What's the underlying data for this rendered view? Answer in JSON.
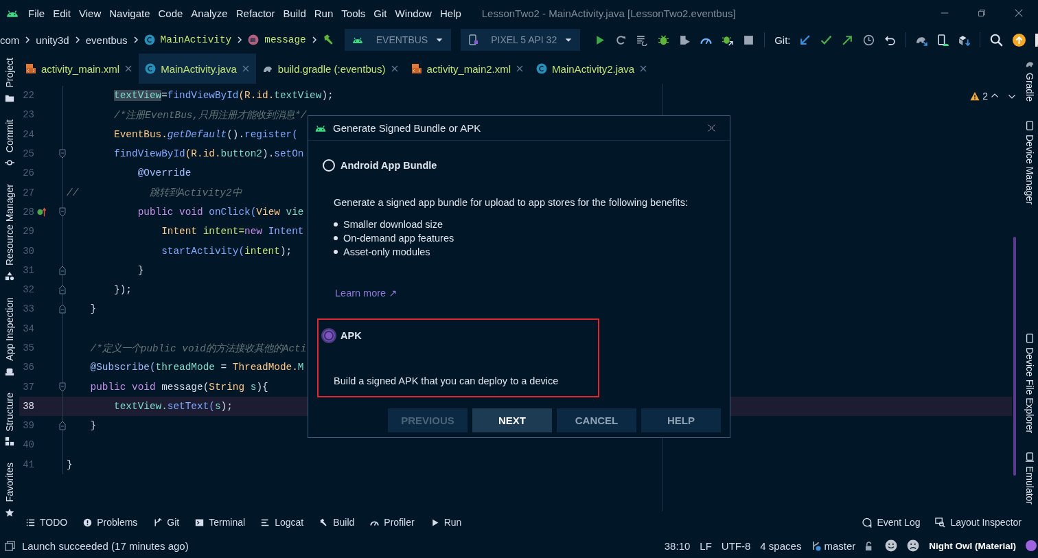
{
  "window": {
    "title": "LessonTwo2 - MainActivity.java [LessonTwo2.eventbus]"
  },
  "menu": [
    "File",
    "Edit",
    "View",
    "Navigate",
    "Code",
    "Analyze",
    "Refactor",
    "Build",
    "Run",
    "Tools",
    "Git",
    "Window",
    "Help"
  ],
  "breadcrumbs": [
    {
      "label": "com",
      "kind": "package"
    },
    {
      "label": "unity3d",
      "kind": "package"
    },
    {
      "label": "eventbus",
      "kind": "package"
    },
    {
      "label": "MainActivity",
      "kind": "class"
    },
    {
      "label": "message",
      "kind": "method"
    }
  ],
  "toolbar": {
    "run_config": "EVENTBUS",
    "device": "PIXEL 5 API 32",
    "git_label": "Git:"
  },
  "tabs": [
    {
      "label": "activity_main.xml",
      "kind": "xml",
      "selected": false
    },
    {
      "label": "MainActivity.java",
      "kind": "class",
      "selected": true
    },
    {
      "label": "build.gradle (:eventbus)",
      "kind": "gradle",
      "selected": false
    },
    {
      "label": "activity_main2.xml",
      "kind": "xml",
      "selected": false
    },
    {
      "label": "MainActivity2.java",
      "kind": "class",
      "selected": false
    }
  ],
  "left_stripe": [
    "Project",
    "Commit",
    "Resource Manager",
    "App Inspection",
    "Structure",
    "Favorites"
  ],
  "right_stripe": {
    "top": [
      "Gradle",
      "Device Manager"
    ],
    "bottom": [
      "Device File Explorer",
      "Emulator"
    ]
  },
  "editor": {
    "inspections": "2",
    "lines": [
      {
        "number": "22",
        "current": false,
        "fold_open": false,
        "fold_close": false,
        "override": false,
        "tokens": [
          {
            "text": "        textView",
            "color": "#7fdbca",
            "selected": true
          },
          {
            "text": "=",
            "color": "#d6deeb"
          },
          {
            "text": "findViewById",
            "color": "#82aaff"
          },
          {
            "text": "(R.id.",
            "color": "#ffcb8b"
          },
          {
            "text": "textView",
            "color": "#7fdbca"
          },
          {
            "text": ");",
            "color": "#d6deeb"
          }
        ]
      },
      {
        "number": "23",
        "current": false,
        "fold_open": false,
        "fold_close": false,
        "override": false,
        "tokens": [
          {
            "text": "        /*注册EventBus,只用注册才能收到消息*/",
            "color": "#637777",
            "italic": true
          }
        ]
      },
      {
        "number": "24",
        "current": false,
        "fold_open": false,
        "fold_close": false,
        "override": false,
        "tokens": [
          {
            "text": "        EventBus.",
            "color": "#ffcb8b"
          },
          {
            "text": "getDefault",
            "color": "#82aaff",
            "italic": true
          },
          {
            "text": "().",
            "color": "#d6deeb"
          },
          {
            "text": "register(",
            "color": "#82aaff"
          }
        ]
      },
      {
        "number": "25",
        "current": false,
        "fold_open": true,
        "fold_close": false,
        "override": false,
        "tokens": [
          {
            "text": "        findViewById",
            "color": "#82aaff"
          },
          {
            "text": "(R.id.",
            "color": "#ffcb8b"
          },
          {
            "text": "button2",
            "color": "#7fdbca"
          },
          {
            "text": ").",
            "color": "#d6deeb"
          },
          {
            "text": "setOn",
            "color": "#82aaff"
          }
        ]
      },
      {
        "number": "26",
        "current": false,
        "fold_open": false,
        "fold_close": false,
        "override": false,
        "tokens": [
          {
            "text": "            @Override",
            "color": "#a2bffc"
          }
        ]
      },
      {
        "number": "27",
        "current": false,
        "fold_open": false,
        "fold_close": false,
        "override": false,
        "tokens": [
          {
            "text": "//            跳转到Activity2中",
            "color": "#637777",
            "italic": true
          }
        ]
      },
      {
        "number": "28",
        "current": false,
        "fold_open": true,
        "fold_close": false,
        "override": true,
        "tokens": [
          {
            "text": "            public void",
            "color": "#c792ea"
          },
          {
            "text": " onClick(",
            "color": "#82aaff"
          },
          {
            "text": "View",
            "color": "#ffcb8b"
          },
          {
            "text": " vie",
            "color": "#7fdbca"
          }
        ]
      },
      {
        "number": "29",
        "current": false,
        "fold_open": false,
        "fold_close": false,
        "override": false,
        "tokens": [
          {
            "text": "                Intent",
            "color": "#ffcb8b"
          },
          {
            "text": " intent=",
            "color": "#c5e478"
          },
          {
            "text": "new",
            "color": "#c792ea"
          },
          {
            "text": " Intent",
            "color": "#82aaff"
          }
        ]
      },
      {
        "number": "30",
        "current": false,
        "fold_open": false,
        "fold_close": false,
        "override": false,
        "tokens": [
          {
            "text": "                startActivity(",
            "color": "#82aaff"
          },
          {
            "text": "intent",
            "color": "#c5e478"
          },
          {
            "text": ");",
            "color": "#d6deeb"
          }
        ]
      },
      {
        "number": "31",
        "current": false,
        "fold_open": false,
        "fold_close": true,
        "override": false,
        "tokens": [
          {
            "text": "            }",
            "color": "#d6deeb"
          }
        ]
      },
      {
        "number": "32",
        "current": false,
        "fold_open": false,
        "fold_close": true,
        "override": false,
        "tokens": [
          {
            "text": "        });",
            "color": "#d6deeb"
          }
        ]
      },
      {
        "number": "33",
        "current": false,
        "fold_open": false,
        "fold_close": true,
        "override": false,
        "tokens": [
          {
            "text": "    }",
            "color": "#d6deeb"
          }
        ]
      },
      {
        "number": "34",
        "current": false,
        "fold_open": false,
        "fold_close": false,
        "override": false
      },
      {
        "number": "35",
        "current": false,
        "fold_open": false,
        "fold_close": false,
        "override": false,
        "tokens": [
          {
            "text": "    /*定义一个public void的方法接收其他的Acti",
            "color": "#637777",
            "italic": true
          }
        ]
      },
      {
        "number": "36",
        "current": false,
        "fold_open": false,
        "fold_close": false,
        "override": false,
        "tokens": [
          {
            "text": "    @Subscribe(",
            "color": "#a2bffc"
          },
          {
            "text": "threadMode",
            "color": "#7fdbca"
          },
          {
            "text": " = ",
            "color": "#d6deeb"
          },
          {
            "text": "ThreadMode.",
            "color": "#ffcb8b"
          },
          {
            "text": "M",
            "color": "#7fdbca"
          }
        ]
      },
      {
        "number": "37",
        "current": false,
        "fold_open": true,
        "fold_close": false,
        "override": false,
        "tokens": [
          {
            "text": "    public void",
            "color": "#c792ea"
          },
          {
            "text": " message(",
            "color": "#d6deeb"
          },
          {
            "text": "String",
            "color": "#ffcb8b"
          },
          {
            "text": " s",
            "color": "#7fdbca"
          },
          {
            "text": "){",
            "color": "#d6deeb"
          }
        ]
      },
      {
        "number": "38",
        "current": true,
        "fold_open": false,
        "fold_close": false,
        "override": false,
        "tokens": [
          {
            "text": "        textView.",
            "color": "#7fdbca"
          },
          {
            "text": "setText(",
            "color": "#82aaff"
          },
          {
            "text": "s",
            "color": "#7fdbca"
          },
          {
            "text": ");",
            "color": "#d6deeb"
          }
        ]
      },
      {
        "number": "39",
        "current": false,
        "fold_open": false,
        "fold_close": true,
        "override": false,
        "tokens": [
          {
            "text": "    }",
            "color": "#d6deeb"
          }
        ]
      },
      {
        "number": "40",
        "current": false,
        "fold_open": false,
        "fold_close": false,
        "override": false
      },
      {
        "number": "41",
        "current": false,
        "fold_open": false,
        "fold_close": false,
        "override": false,
        "tokens": [
          {
            "text": "}",
            "color": "#d6deeb"
          }
        ]
      }
    ]
  },
  "dialog": {
    "title": "Generate Signed Bundle or APK",
    "options": [
      {
        "label": "Android App Bundle",
        "selected": false,
        "highlighted": false,
        "description": "Generate a signed app bundle for upload to app stores for the following benefits:",
        "bullets": [
          "Smaller download size",
          "On-demand app features",
          "Asset-only modules"
        ],
        "link": "Learn more ↗"
      },
      {
        "label": "APK",
        "selected": true,
        "highlighted": true,
        "description": "Build a signed APK that you can deploy to a device"
      }
    ],
    "buttons": [
      {
        "label": "PREVIOUS",
        "disabled": true,
        "default": false
      },
      {
        "label": "NEXT",
        "disabled": false,
        "default": true
      },
      {
        "label": "CANCEL",
        "disabled": false,
        "default": false
      },
      {
        "label": "HELP",
        "disabled": false,
        "default": false
      }
    ]
  },
  "tool_windows": {
    "left": [
      "TODO",
      "Problems",
      "Git",
      "Terminal",
      "Logcat",
      "Build",
      "Profiler",
      "Run"
    ],
    "right": [
      "Event Log",
      "Layout Inspector"
    ]
  },
  "status_bar": {
    "message": "Launch succeeded (17 minutes ago)",
    "position": "38:10",
    "line_separator": "LF",
    "encoding": "UTF-8",
    "indent": "4 spaces",
    "branch": "master",
    "theme": "Night Owl (Material)"
  }
}
